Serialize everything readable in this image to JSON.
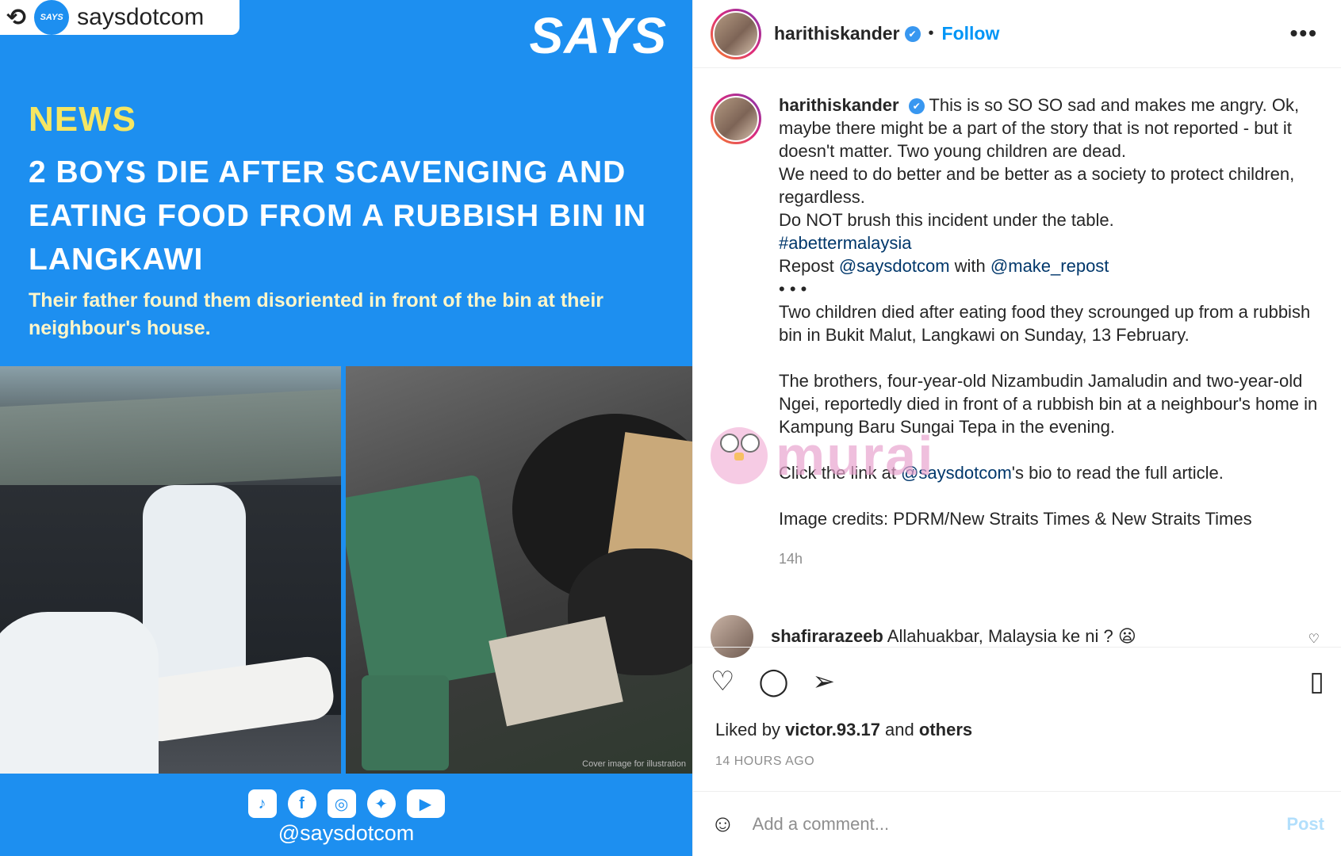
{
  "image": {
    "repost": {
      "icon": "repost-icon",
      "glyph": "⟲",
      "logo_text": "SAYS",
      "handle": "saysdotcom"
    },
    "brand": "SAYS",
    "tag": "NEWS",
    "headline": "2 BOYS DIE AFTER SCAVENGING AND EATING FOOD FROM A RUBBISH BIN IN LANGKAWI",
    "subhead": "Their father found them disoriented in front of the bin at their neighbour's house.",
    "photo_credit": "Cover image for illustration",
    "social_icons": [
      "tiktok-icon",
      "facebook-icon",
      "instagram-icon",
      "twitter-icon",
      "youtube-icon"
    ],
    "social_glyphs": [
      "♪",
      "f",
      "◎",
      "✦",
      "▶"
    ],
    "footer_handle": "@saysdotcom",
    "colors": {
      "background": "#1d8ff0",
      "tag": "#f5e663",
      "headline": "#ffffff",
      "subhead": "#fff6c9"
    }
  },
  "panel": {
    "header": {
      "username": "harithiskander",
      "verified_icon": "✔",
      "separator": "•",
      "follow_label": "Follow",
      "more_label": "•••"
    },
    "caption": {
      "username": "harithiskander",
      "line1": "This is so SO SO sad and makes me angry. Ok, maybe there might be a part of the story that is not reported - but it doesn't matter. Two young children are dead.",
      "line2": "We need to do better and be better as a society to protect children, regardless.",
      "line3": "Do NOT brush this incident under the table.",
      "hashtag": "#abettermalaysia",
      "repost_prefix": "Repost ",
      "repost_source": "@saysdotcom",
      "repost_mid": " with ",
      "repost_tool": "@make_repost",
      "dots": "•  •  •",
      "para1": "Two children died after eating food they scrounged up from a rubbish bin in Bukit Malut, Langkawi on Sunday, 13 February.",
      "para2": "The brothers, four-year-old Nizambudin Jamaludin and two-year-old Ngei, reportedly died in front of a rubbish bin at a neighbour's home in Kampung Baru Sungai Tepa in the evening.",
      "para3_prefix": "Click the link at ",
      "para3_link": "@saysdotcom",
      "para3_suffix": "'s bio to read the full article.",
      "para4": "Image credits: PDRM/New Straits Times & New Straits Times",
      "time": "14h"
    },
    "watermark": {
      "text": "murai"
    },
    "comment": {
      "username": "shafirarazeeb",
      "text": "Allahuakbar, Malaysia ke ni ? 😦",
      "like_icon": "♡"
    },
    "actions": {
      "like_icon": "♡",
      "comment_icon": "◯",
      "share_icon": "➢",
      "bookmark_icon": "▯"
    },
    "likes": {
      "prefix": "Liked by ",
      "user": "victor.93.17",
      "mid": " and ",
      "others": "others"
    },
    "time_ago": "14 HOURS AGO",
    "add_comment": {
      "emoji_icon": "☺",
      "placeholder": "Add a comment...",
      "post_label": "Post"
    }
  }
}
